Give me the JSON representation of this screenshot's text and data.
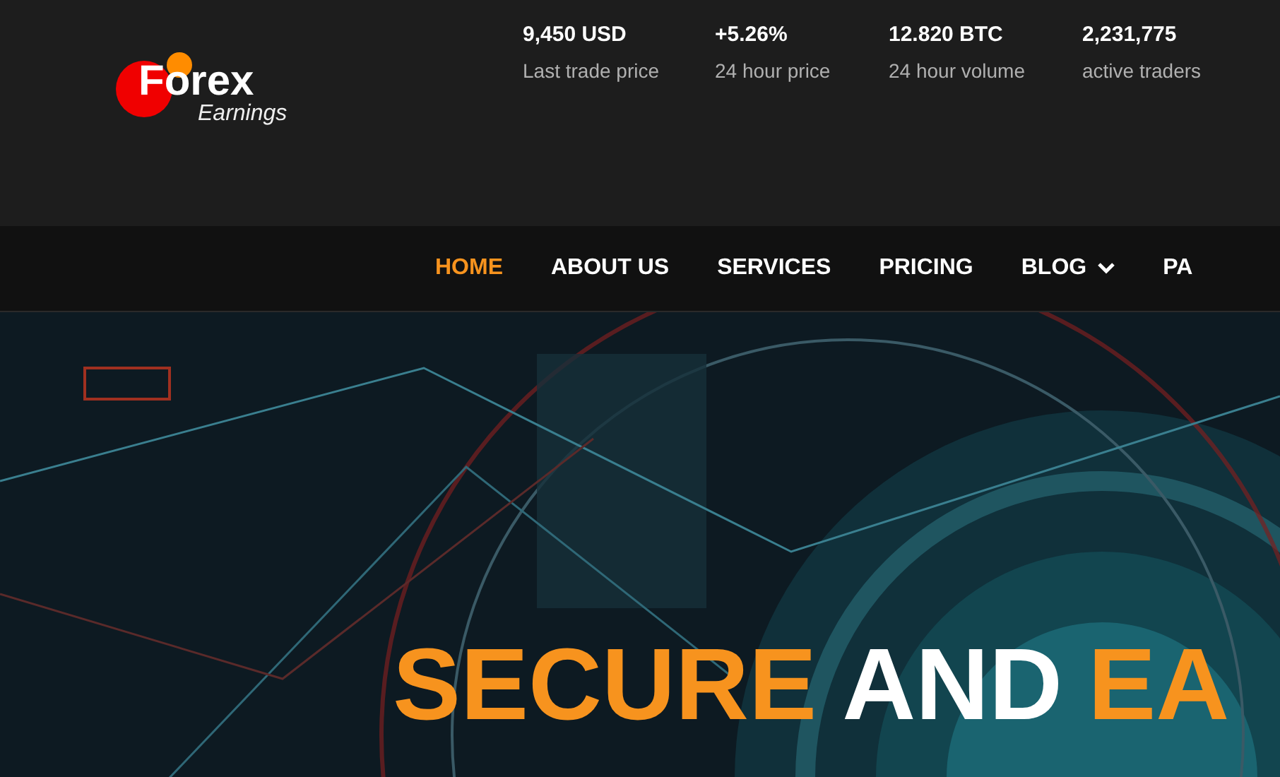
{
  "logo": {
    "brand": "Forex",
    "tagline": "Earnings"
  },
  "stats": [
    {
      "value": "9,450 USD",
      "label": "Last trade price"
    },
    {
      "value": "+5.26%",
      "label": "24 hour price"
    },
    {
      "value": "12.820 BTC",
      "label": "24 hour volume"
    },
    {
      "value": "2,231,775",
      "label": "active traders"
    }
  ],
  "nav": [
    {
      "label": "HOME",
      "selected": true,
      "dropdown": false
    },
    {
      "label": "ABOUT US",
      "selected": false,
      "dropdown": false
    },
    {
      "label": "SERVICES",
      "selected": false,
      "dropdown": false
    },
    {
      "label": "PRICING",
      "selected": false,
      "dropdown": false
    },
    {
      "label": "BLOG",
      "selected": false,
      "dropdown": true
    },
    {
      "label": "PA",
      "selected": false,
      "dropdown": false
    }
  ],
  "hero": {
    "kind": "picture",
    "headline": [
      {
        "text": "SECURE",
        "accent": true
      },
      {
        "text": "AND",
        "accent": false
      },
      {
        "text": "EA",
        "accent": true
      }
    ]
  }
}
